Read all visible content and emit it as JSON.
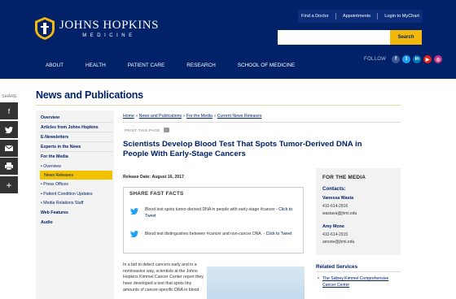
{
  "header": {
    "logo_main": "JOHNS HOPKINS",
    "logo_sub": "MEDICINE",
    "top_links": [
      "Find a Doctor",
      "Appointments",
      "Login to MyChart"
    ],
    "search_placeholder": "",
    "search_button": "Search",
    "nav": [
      "ABOUT",
      "HEALTH",
      "PATIENT CARE",
      "RESEARCH",
      "SCHOOL OF MEDICINE"
    ],
    "follow_label": "FOLLOW",
    "social": [
      {
        "icon": "facebook-icon",
        "glyph": "f",
        "color": "#3b5998"
      },
      {
        "icon": "twitter-icon",
        "glyph": "t",
        "color": "#1da1f2"
      },
      {
        "icon": "linkedin-icon",
        "glyph": "in",
        "color": "#0077b5"
      },
      {
        "icon": "youtube-icon",
        "glyph": "▶",
        "color": "#e62117"
      },
      {
        "icon": "instagram-icon",
        "glyph": "◎",
        "color": "#c13584"
      }
    ]
  },
  "share": {
    "label": "SHARE",
    "buttons": [
      "facebook-icon",
      "twitter-icon",
      "email-icon",
      "print-icon",
      "plus-icon"
    ]
  },
  "page_title": "News and Publications",
  "left_nav": {
    "items": [
      {
        "label": "Overview",
        "bold": true
      },
      {
        "label": "Articles from Johns Hopkins",
        "bold": true
      },
      {
        "label": "E-Newsletters",
        "bold": true
      },
      {
        "label": "Experts in the News",
        "bold": true
      },
      {
        "label": "For the Media",
        "bold": true
      },
      {
        "label": "Overview",
        "bold": false
      },
      {
        "label": "News Releases",
        "bold": false,
        "active": true
      },
      {
        "label": "Press Offices",
        "bold": false
      },
      {
        "label": "Patient Condition Updates",
        "bold": false
      },
      {
        "label": "Media Relations Staff",
        "bold": false
      },
      {
        "label": "Web Features",
        "bold": true
      },
      {
        "label": "Audio",
        "bold": true
      }
    ]
  },
  "breadcrumb": [
    "Home",
    "News and Publications",
    "For the Media",
    "Current News Releases"
  ],
  "print_label": "PRINT THIS PAGE",
  "article": {
    "title": "Scientists Develop Blood Test That Spots Tumor-Derived DNA in People With Early-Stage Cancers",
    "release_label": "Release Date:",
    "release_date": "August 16, 2017",
    "facts_title": "SHARE FAST FACTS",
    "facts": [
      {
        "text": "Blood test spots tumor-derived DNA in people with early-stage #cancer - ",
        "link": "Click to Tweet"
      },
      {
        "text": "Blood test distinguishes between #cancer and non-cancer DNA. - ",
        "link": "Click to Tweet"
      }
    ],
    "body": "In a bid to detect cancers early and in a noninvasive way, scientists at the Johns Hopkins Kimmel Cancer Center report they have developed a test that spots tiny amounts of cancer-specific DNA in blood"
  },
  "media_box": {
    "title": "FOR THE MEDIA",
    "contacts_label": "Contacts:",
    "contacts": [
      {
        "name": "Vanessa Wasta",
        "phone": "410-614-2916",
        "email": "wastava@jhmi.edu"
      },
      {
        "name": "Amy Mone",
        "phone": "410-614-2915",
        "email": "amone@jhmi.edu"
      }
    ]
  },
  "related": {
    "title": "Related Services",
    "links": [
      "The Sidney Kimmel Comprehensive Cancer Center"
    ]
  },
  "colors": {
    "brand_navy": "#012169",
    "accent_gold": "#f2b80c"
  }
}
